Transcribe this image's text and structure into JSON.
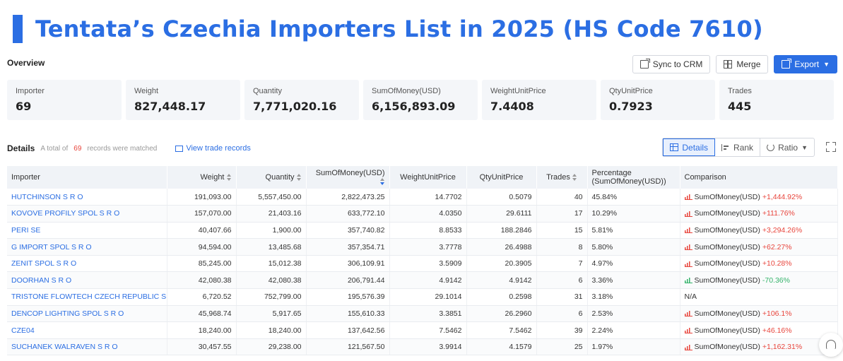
{
  "title": "Tentata’s Czechia Importers List in 2025 (HS Code 7610)",
  "overview_label": "Overview",
  "toolbar": {
    "sync_label": "Sync to CRM",
    "merge_label": "Merge",
    "export_label": "Export"
  },
  "stats": [
    {
      "label": "Importer",
      "value": "69"
    },
    {
      "label": "Weight",
      "value": "827,448.17"
    },
    {
      "label": "Quantity",
      "value": "7,771,020.16"
    },
    {
      "label": "SumOfMoney(USD)",
      "value": "6,156,893.09"
    },
    {
      "label": "WeightUnitPrice",
      "value": "7.4408"
    },
    {
      "label": "QtyUnitPrice",
      "value": "0.7923"
    },
    {
      "label": "Trades",
      "value": "445"
    }
  ],
  "details": {
    "label": "Details",
    "match_prefix": "A total of",
    "match_count": "69",
    "match_suffix": "records were matched",
    "trade_link": "View trade records"
  },
  "view_tabs": {
    "details": "Details",
    "rank": "Rank",
    "ratio": "Ratio"
  },
  "table": {
    "headers": {
      "importer": "Importer",
      "weight": "Weight",
      "quantity": "Quantity",
      "sum": "SumOfMoney(USD)",
      "wup": "WeightUnitPrice",
      "qup": "QtyUnitPrice",
      "trades": "Trades",
      "pct_line1": "Percentage",
      "pct_line2": "(SumOfMoney(USD))",
      "comparison": "Comparison"
    },
    "rows": [
      {
        "importer": "HUTCHINSON S R O",
        "weight": "191,093.00",
        "quantity": "5,557,450.00",
        "sum": "2,822,473.25",
        "wup": "14.7702",
        "qup": "0.5079",
        "trades": "40",
        "pct": "45.84%",
        "cmp_label": "SumOfMoney(USD)",
        "cmp_value": "+1,444.92%",
        "cmp_dir": "up"
      },
      {
        "importer": "KOVOVE PROFILY SPOL S R O",
        "weight": "157,070.00",
        "quantity": "21,403.16",
        "sum": "633,772.10",
        "wup": "4.0350",
        "qup": "29.6111",
        "trades": "17",
        "pct": "10.29%",
        "cmp_label": "SumOfMoney(USD)",
        "cmp_value": "+111.76%",
        "cmp_dir": "up"
      },
      {
        "importer": "PERI SE",
        "weight": "40,407.66",
        "quantity": "1,900.00",
        "sum": "357,740.82",
        "wup": "8.8533",
        "qup": "188.2846",
        "trades": "15",
        "pct": "5.81%",
        "cmp_label": "SumOfMoney(USD)",
        "cmp_value": "+3,294.26%",
        "cmp_dir": "up"
      },
      {
        "importer": "G IMPORT SPOL S R O",
        "weight": "94,594.00",
        "quantity": "13,485.68",
        "sum": "357,354.71",
        "wup": "3.7778",
        "qup": "26.4988",
        "trades": "8",
        "pct": "5.80%",
        "cmp_label": "SumOfMoney(USD)",
        "cmp_value": "+62.27%",
        "cmp_dir": "up"
      },
      {
        "importer": "ZENIT SPOL S R O",
        "weight": "85,245.00",
        "quantity": "15,012.38",
        "sum": "306,109.91",
        "wup": "3.5909",
        "qup": "20.3905",
        "trades": "7",
        "pct": "4.97%",
        "cmp_label": "SumOfMoney(USD)",
        "cmp_value": "+10.28%",
        "cmp_dir": "up"
      },
      {
        "importer": "DOORHAN S R O",
        "weight": "42,080.38",
        "quantity": "42,080.38",
        "sum": "206,791.44",
        "wup": "4.9142",
        "qup": "4.9142",
        "trades": "6",
        "pct": "3.36%",
        "cmp_label": "SumOfMoney(USD)",
        "cmp_value": "-70.36%",
        "cmp_dir": "down"
      },
      {
        "importer": "TRISTONE FLOWTECH CZECH REPUBLIC SRO",
        "weight": "6,720.52",
        "quantity": "752,799.00",
        "sum": "195,576.39",
        "wup": "29.1014",
        "qup": "0.2598",
        "trades": "31",
        "pct": "3.18%",
        "cmp_label": "N/A",
        "cmp_value": "",
        "cmp_dir": "none"
      },
      {
        "importer": "DENCOP LIGHTING SPOL S R O",
        "weight": "45,968.74",
        "quantity": "5,917.65",
        "sum": "155,610.33",
        "wup": "3.3851",
        "qup": "26.2960",
        "trades": "6",
        "pct": "2.53%",
        "cmp_label": "SumOfMoney(USD)",
        "cmp_value": "+106.1%",
        "cmp_dir": "up"
      },
      {
        "importer": "CZE04",
        "weight": "18,240.00",
        "quantity": "18,240.00",
        "sum": "137,642.56",
        "wup": "7.5462",
        "qup": "7.5462",
        "trades": "39",
        "pct": "2.24%",
        "cmp_label": "SumOfMoney(USD)",
        "cmp_value": "+46.16%",
        "cmp_dir": "up"
      },
      {
        "importer": "SUCHANEK WALRAVEN S R O",
        "weight": "30,457.55",
        "quantity": "29,238.00",
        "sum": "121,567.50",
        "wup": "3.9914",
        "qup": "4.1579",
        "trades": "25",
        "pct": "1.97%",
        "cmp_label": "SumOfMoney(USD)",
        "cmp_value": "+1,162.31%",
        "cmp_dir": "up"
      }
    ]
  },
  "colors": {
    "accent": "#2b6ee3",
    "up": "#e8453c",
    "down": "#34b36a"
  }
}
